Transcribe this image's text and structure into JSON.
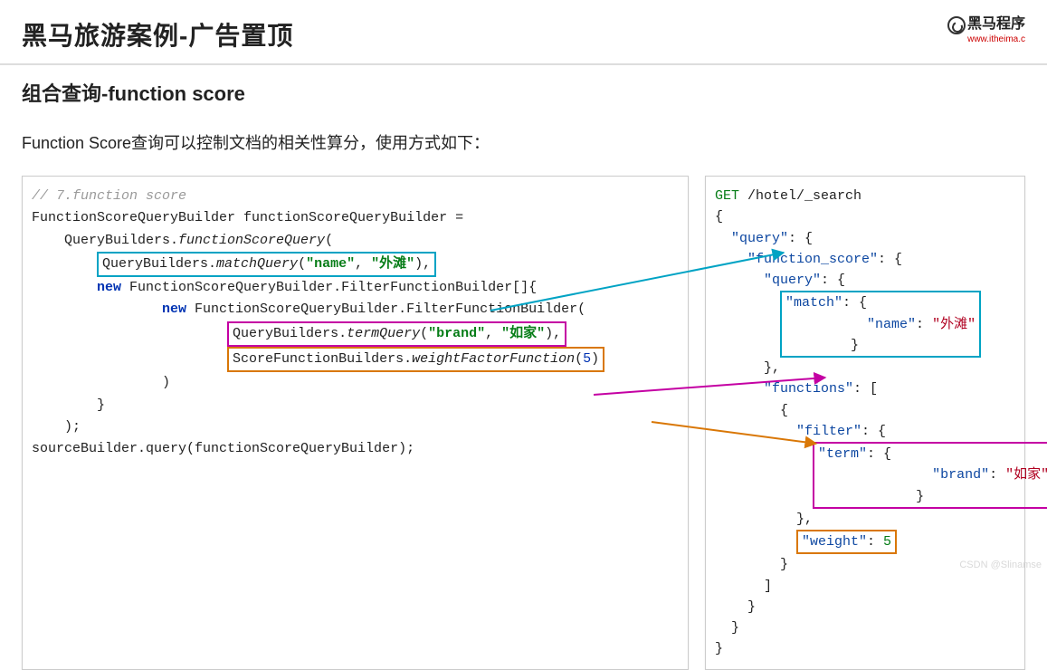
{
  "header": {
    "title": "黑马旅游案例-广告置顶",
    "logo_text": "黑马程序",
    "logo_sub": "www.itheima.c"
  },
  "section": {
    "title": "组合查询-function score",
    "desc": "Function Score查询可以控制文档的相关性算分，使用方式如下："
  },
  "java": {
    "l1_comment": "// 7.function score",
    "l2_part1": "FunctionScoreQueryBuilder functionScoreQueryBuilder =",
    "l3_part1": "    QueryBuilders.",
    "l3_call": "functionScoreQuery",
    "l3_part2": "(",
    "l4_prefix": "        ",
    "l4_part1": "QueryBuilders.",
    "l4_call": "matchQuery",
    "l4_open": "(",
    "l4_str1": "\"name\"",
    "l4_comma": ", ",
    "l4_str2": "\"外滩\"",
    "l4_close": "),",
    "l5_prefix": "        ",
    "l5_kw": "new",
    "l5_rest": " FunctionScoreQueryBuilder.FilterFunctionBuilder[]{",
    "l6_prefix": "                ",
    "l6_kw": "new",
    "l6_rest": " FunctionScoreQueryBuilder.FilterFunctionBuilder(",
    "l7_prefix": "                        ",
    "l7_part1": "QueryBuilders.",
    "l7_call": "termQuery",
    "l7_open": "(",
    "l7_str1": "\"brand\"",
    "l7_comma": ", ",
    "l7_str2": "\"如家\"",
    "l7_close": "),",
    "l8_prefix": "                        ",
    "l8_part1": "ScoreFunctionBuilders.",
    "l8_call": "weightFactorFunction",
    "l8_open": "(",
    "l8_num": "5",
    "l8_close": ")",
    "l9": "                )",
    "l10": "        }",
    "l11": "    );",
    "l12": "sourceBuilder.query(functionScoreQueryBuilder);"
  },
  "json": {
    "r1_method": "GET",
    "r1_path": " /hotel/_search",
    "r2": "{",
    "r3_pre": "  ",
    "r3_key": "\"query\"",
    "r3_post": ": {",
    "r4_pre": "    ",
    "r4_key": "\"function_score\"",
    "r4_post": ": {",
    "r5_pre": "      ",
    "r5_key": "\"query\"",
    "r5_post": ": {",
    "r6_pre": "        ",
    "r6_key": "\"match\"",
    "r6_post": ": {",
    "r7_pre": "          ",
    "r7_key": "\"name\"",
    "r7_mid": ": ",
    "r7_val": "\"外滩\"",
    "r8_pre": "        ",
    "r8": "}",
    "r9_pre": "      ",
    "r9": "},",
    "r10_pre": "      ",
    "r10_key": "\"functions\"",
    "r10_post": ": [",
    "r11_pre": "        ",
    "r11": "{",
    "r12_pre": "          ",
    "r12_key": "\"filter\"",
    "r12_post": ": {",
    "r13_pre": "            ",
    "r13_key": "\"term\"",
    "r13_post": ": {",
    "r14_pre": "              ",
    "r14_key": "\"brand\"",
    "r14_mid": ": ",
    "r14_val": "\"如家\"",
    "r15_pre": "            ",
    "r15": "}",
    "r16_pre": "          ",
    "r16": "},",
    "r17_pre": "          ",
    "r17_key": "\"weight\"",
    "r17_mid": ": ",
    "r17_val": "5",
    "r18_pre": "        ",
    "r18": "}",
    "r19_pre": "      ",
    "r19": "]",
    "r20_pre": "    ",
    "r20": "}",
    "r21_pre": "  ",
    "r21": "}",
    "r22": "}"
  },
  "watermark": "CSDN @Slinamse"
}
